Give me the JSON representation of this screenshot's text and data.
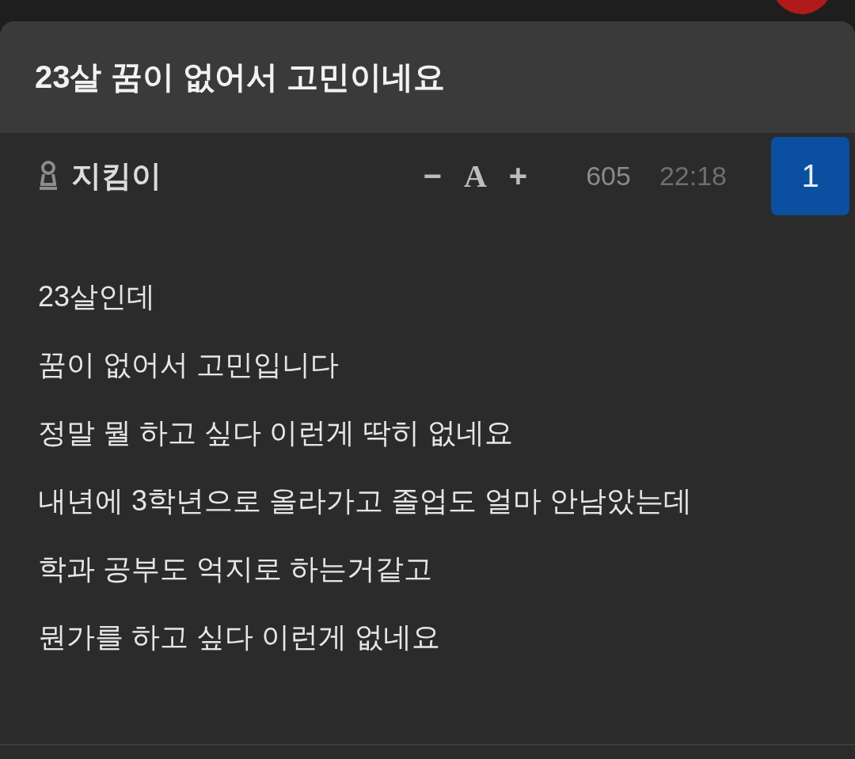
{
  "title": "23살 꿈이 없어서 고민이네요",
  "meta": {
    "author": "지킴이",
    "font_controls": [
      "−",
      "A",
      "+"
    ],
    "views": "605",
    "time": "22:18",
    "comment_count": "1"
  },
  "body": [
    "23살인데",
    "꿈이 없어서 고민입니다",
    "정말 뭘 하고 싶다 이런게 딱히 없네요",
    "내년에 3학년으로 올라가고 졸업도 얼마 안남았는데",
    "학과 공부도 억지로 하는거같고",
    "뭔가를 하고 싶다 이런게 없네요"
  ]
}
